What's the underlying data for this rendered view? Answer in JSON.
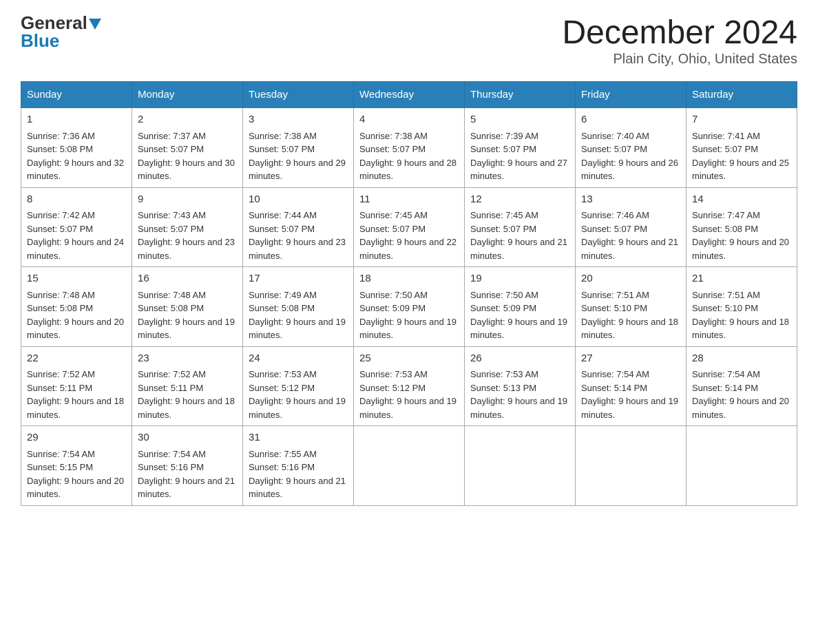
{
  "header": {
    "logo_general": "General",
    "logo_blue": "Blue",
    "title": "December 2024",
    "subtitle": "Plain City, Ohio, United States"
  },
  "calendar": {
    "days_of_week": [
      "Sunday",
      "Monday",
      "Tuesday",
      "Wednesday",
      "Thursday",
      "Friday",
      "Saturday"
    ],
    "weeks": [
      [
        {
          "day": "1",
          "sunrise": "7:36 AM",
          "sunset": "5:08 PM",
          "daylight": "9 hours and 32 minutes."
        },
        {
          "day": "2",
          "sunrise": "7:37 AM",
          "sunset": "5:07 PM",
          "daylight": "9 hours and 30 minutes."
        },
        {
          "day": "3",
          "sunrise": "7:38 AM",
          "sunset": "5:07 PM",
          "daylight": "9 hours and 29 minutes."
        },
        {
          "day": "4",
          "sunrise": "7:38 AM",
          "sunset": "5:07 PM",
          "daylight": "9 hours and 28 minutes."
        },
        {
          "day": "5",
          "sunrise": "7:39 AM",
          "sunset": "5:07 PM",
          "daylight": "9 hours and 27 minutes."
        },
        {
          "day": "6",
          "sunrise": "7:40 AM",
          "sunset": "5:07 PM",
          "daylight": "9 hours and 26 minutes."
        },
        {
          "day": "7",
          "sunrise": "7:41 AM",
          "sunset": "5:07 PM",
          "daylight": "9 hours and 25 minutes."
        }
      ],
      [
        {
          "day": "8",
          "sunrise": "7:42 AM",
          "sunset": "5:07 PM",
          "daylight": "9 hours and 24 minutes."
        },
        {
          "day": "9",
          "sunrise": "7:43 AM",
          "sunset": "5:07 PM",
          "daylight": "9 hours and 23 minutes."
        },
        {
          "day": "10",
          "sunrise": "7:44 AM",
          "sunset": "5:07 PM",
          "daylight": "9 hours and 23 minutes."
        },
        {
          "day": "11",
          "sunrise": "7:45 AM",
          "sunset": "5:07 PM",
          "daylight": "9 hours and 22 minutes."
        },
        {
          "day": "12",
          "sunrise": "7:45 AM",
          "sunset": "5:07 PM",
          "daylight": "9 hours and 21 minutes."
        },
        {
          "day": "13",
          "sunrise": "7:46 AM",
          "sunset": "5:07 PM",
          "daylight": "9 hours and 21 minutes."
        },
        {
          "day": "14",
          "sunrise": "7:47 AM",
          "sunset": "5:08 PM",
          "daylight": "9 hours and 20 minutes."
        }
      ],
      [
        {
          "day": "15",
          "sunrise": "7:48 AM",
          "sunset": "5:08 PM",
          "daylight": "9 hours and 20 minutes."
        },
        {
          "day": "16",
          "sunrise": "7:48 AM",
          "sunset": "5:08 PM",
          "daylight": "9 hours and 19 minutes."
        },
        {
          "day": "17",
          "sunrise": "7:49 AM",
          "sunset": "5:08 PM",
          "daylight": "9 hours and 19 minutes."
        },
        {
          "day": "18",
          "sunrise": "7:50 AM",
          "sunset": "5:09 PM",
          "daylight": "9 hours and 19 minutes."
        },
        {
          "day": "19",
          "sunrise": "7:50 AM",
          "sunset": "5:09 PM",
          "daylight": "9 hours and 19 minutes."
        },
        {
          "day": "20",
          "sunrise": "7:51 AM",
          "sunset": "5:10 PM",
          "daylight": "9 hours and 18 minutes."
        },
        {
          "day": "21",
          "sunrise": "7:51 AM",
          "sunset": "5:10 PM",
          "daylight": "9 hours and 18 minutes."
        }
      ],
      [
        {
          "day": "22",
          "sunrise": "7:52 AM",
          "sunset": "5:11 PM",
          "daylight": "9 hours and 18 minutes."
        },
        {
          "day": "23",
          "sunrise": "7:52 AM",
          "sunset": "5:11 PM",
          "daylight": "9 hours and 18 minutes."
        },
        {
          "day": "24",
          "sunrise": "7:53 AM",
          "sunset": "5:12 PM",
          "daylight": "9 hours and 19 minutes."
        },
        {
          "day": "25",
          "sunrise": "7:53 AM",
          "sunset": "5:12 PM",
          "daylight": "9 hours and 19 minutes."
        },
        {
          "day": "26",
          "sunrise": "7:53 AM",
          "sunset": "5:13 PM",
          "daylight": "9 hours and 19 minutes."
        },
        {
          "day": "27",
          "sunrise": "7:54 AM",
          "sunset": "5:14 PM",
          "daylight": "9 hours and 19 minutes."
        },
        {
          "day": "28",
          "sunrise": "7:54 AM",
          "sunset": "5:14 PM",
          "daylight": "9 hours and 20 minutes."
        }
      ],
      [
        {
          "day": "29",
          "sunrise": "7:54 AM",
          "sunset": "5:15 PM",
          "daylight": "9 hours and 20 minutes."
        },
        {
          "day": "30",
          "sunrise": "7:54 AM",
          "sunset": "5:16 PM",
          "daylight": "9 hours and 21 minutes."
        },
        {
          "day": "31",
          "sunrise": "7:55 AM",
          "sunset": "5:16 PM",
          "daylight": "9 hours and 21 minutes."
        },
        null,
        null,
        null,
        null
      ]
    ]
  }
}
